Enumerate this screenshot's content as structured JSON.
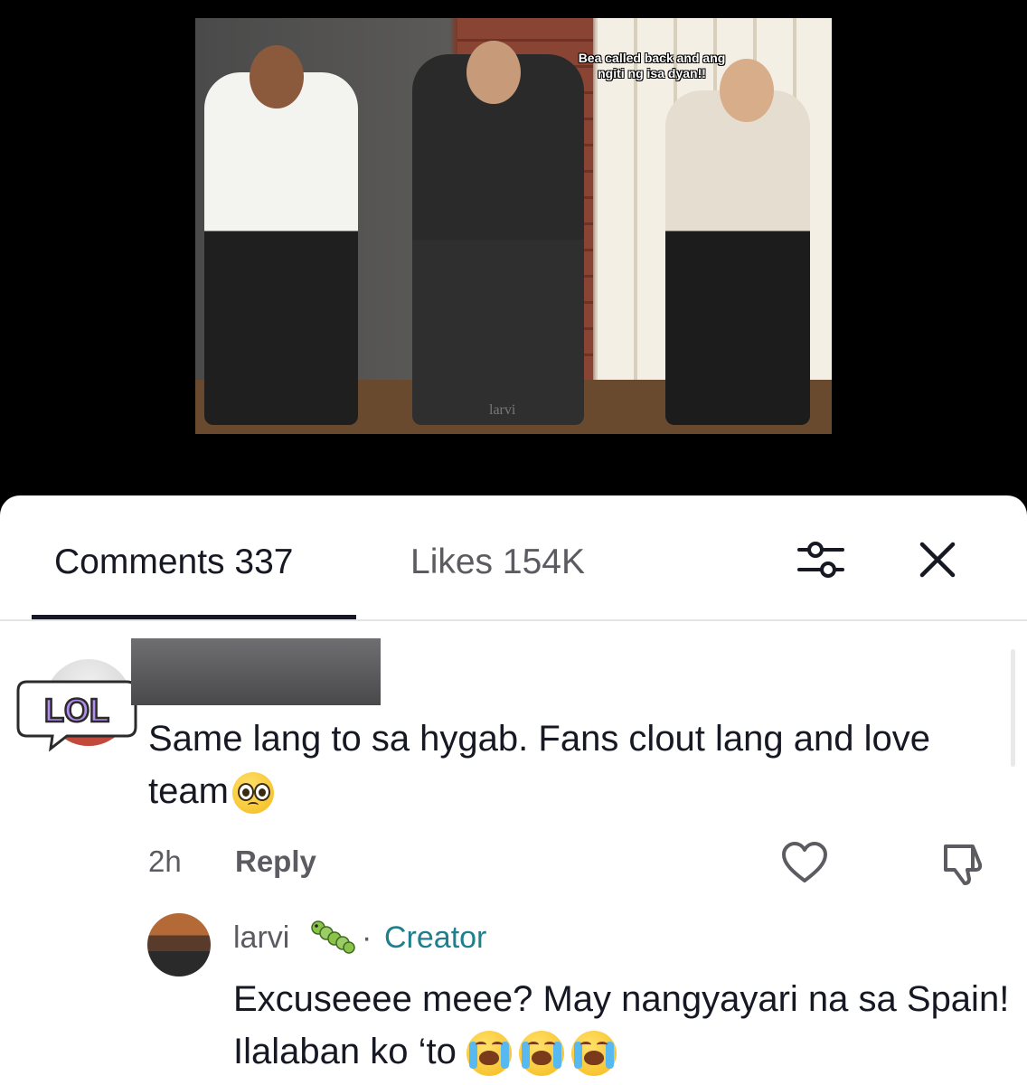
{
  "video": {
    "caption": "Bea called back and ang\nngiti ng isa dyan!!",
    "watermark": "larvi"
  },
  "tabs": {
    "comments": "Comments 337",
    "likes": "Likes 154K"
  },
  "comment": {
    "badge": "LOL",
    "text": "Same lang to sa hygab. Fans clout lang and love team",
    "emoji": "pleading-face",
    "time": "2h",
    "reply_label": "Reply"
  },
  "reply": {
    "author": "larvi",
    "author_badge_icon": "worm-icon",
    "separator": "·",
    "role": "Creator",
    "text": "Excuseeee meee? May nangyayari na sa Spain! Ilalaban ko ‘to",
    "emojis": [
      "crying-face",
      "crying-face",
      "crying-face"
    ]
  },
  "colors": {
    "creator": "#1f7f8c",
    "text": "#161823",
    "muted": "#5b5b61"
  }
}
